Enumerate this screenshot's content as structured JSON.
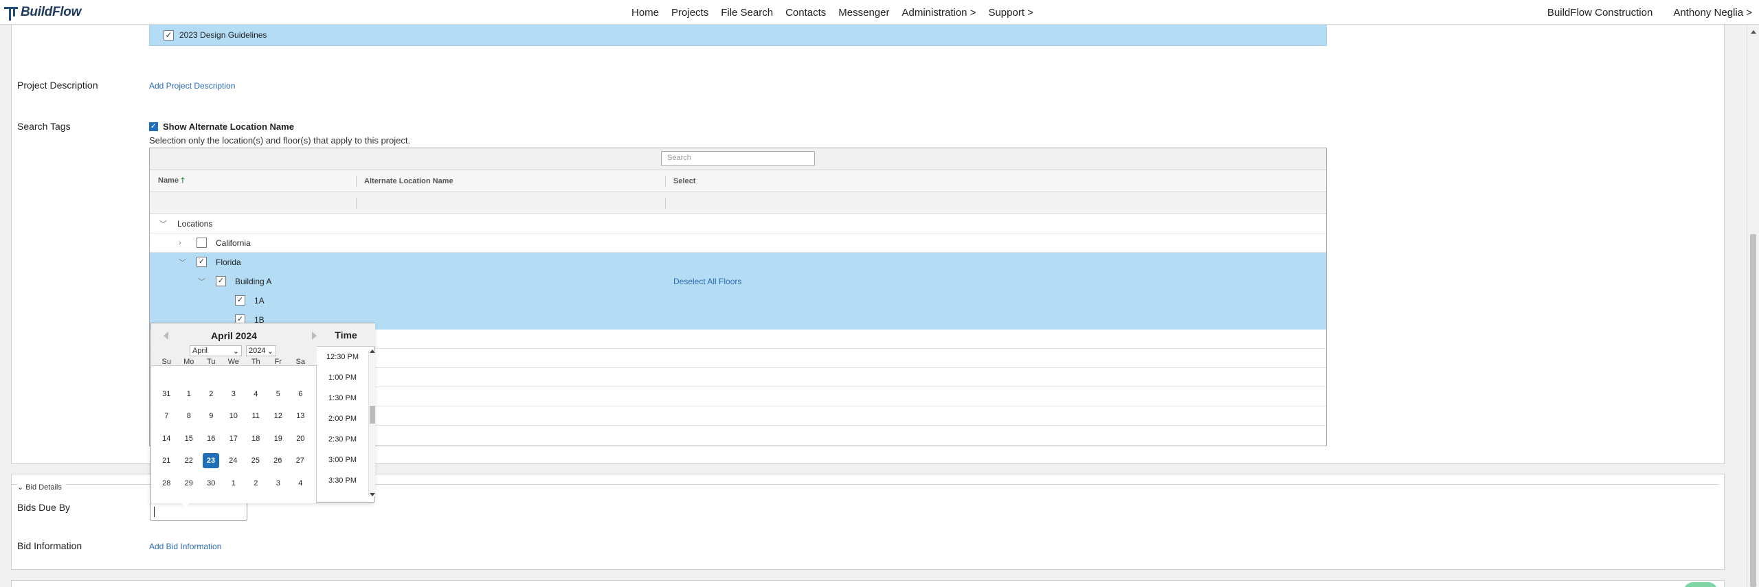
{
  "nav": {
    "logo": "BuildFlow",
    "items": [
      "Home",
      "Projects",
      "File Search",
      "Contacts",
      "Messenger",
      "Administration >",
      "Support >"
    ],
    "company": "BuildFlow Construction",
    "user": "Anthony Neglia >"
  },
  "banner": {
    "label": "2023 Design Guidelines"
  },
  "project_description": {
    "label": "Project Description",
    "link": "Add Project Description"
  },
  "search_tags": {
    "label": "Search Tags",
    "show_alt_label": "Show Alternate Location Name",
    "help": "Selection only the location(s) and floor(s) that apply to this project.",
    "search_placeholder": "Search",
    "columns": [
      "Name",
      "Alternate Location Name",
      "Select"
    ],
    "sort_icon": "arrow-up",
    "rows": {
      "locations": "Locations",
      "california": "California",
      "florida": "Florida",
      "building_a": "Building A",
      "deselect": "Deselect All Floors",
      "floor_1a": "1A",
      "floor_1b": "1B"
    }
  },
  "bid_details": {
    "section": "Bid Details",
    "bids_due_label": "Bids Due By",
    "bid_info_label": "Bid Information",
    "bid_info_link": "Add Bid Information"
  },
  "datepicker": {
    "title": "April 2024",
    "month_select": "April",
    "year_select": "2024",
    "weekdays": [
      "Su",
      "Mo",
      "Tu",
      "We",
      "Th",
      "Fr",
      "Sa"
    ],
    "weeks": [
      [
        "31",
        "1",
        "2",
        "3",
        "4",
        "5",
        "6"
      ],
      [
        "7",
        "8",
        "9",
        "10",
        "11",
        "12",
        "13"
      ],
      [
        "14",
        "15",
        "16",
        "17",
        "18",
        "19",
        "20"
      ],
      [
        "21",
        "22",
        "23",
        "24",
        "25",
        "26",
        "27"
      ],
      [
        "28",
        "29",
        "30",
        "1",
        "2",
        "3",
        "4"
      ]
    ],
    "selected_day": "23",
    "time_header": "Time",
    "times": [
      "12:30 PM",
      "1:00 PM",
      "1:30 PM",
      "2:00 PM",
      "2:30 PM",
      "3:00 PM",
      "3:30 PM"
    ]
  },
  "colors": {
    "accent": "#1e6fb8",
    "selected_row": "#b5dcf5",
    "link": "#2a6db5"
  }
}
